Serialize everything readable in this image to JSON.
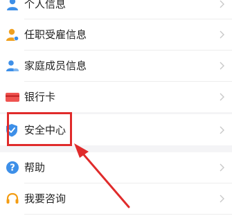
{
  "menu": {
    "items": [
      {
        "key": "personal-info",
        "label": "个人信息",
        "icon": "person-icon"
      },
      {
        "key": "employment-info",
        "label": "任职受雇信息",
        "icon": "employee-badge-icon"
      },
      {
        "key": "family-info",
        "label": "家庭成员信息",
        "icon": "family-members-icon"
      },
      {
        "key": "bank-card",
        "label": "银行卡",
        "icon": "bank-card-icon"
      },
      {
        "key": "security-center",
        "label": "安全中心",
        "icon": "shield-check-icon"
      },
      {
        "key": "help",
        "label": "帮助",
        "icon": "help-question-icon"
      },
      {
        "key": "consult",
        "label": "我要咨询",
        "icon": "headset-icon"
      }
    ]
  },
  "annotation": {
    "highlight_target": "security-center",
    "highlight_color": "#e02b2b"
  },
  "colors": {
    "person": "#3d8fe8",
    "employee": "#f0a01f",
    "family": "#3d8fe8",
    "bank": "#ef5350",
    "shield": "#3d8fe8",
    "help": "#3d8fe8",
    "headset": "#f39c12",
    "chevron": "#c8c8c8",
    "section_gap": "#f4f4f6"
  }
}
